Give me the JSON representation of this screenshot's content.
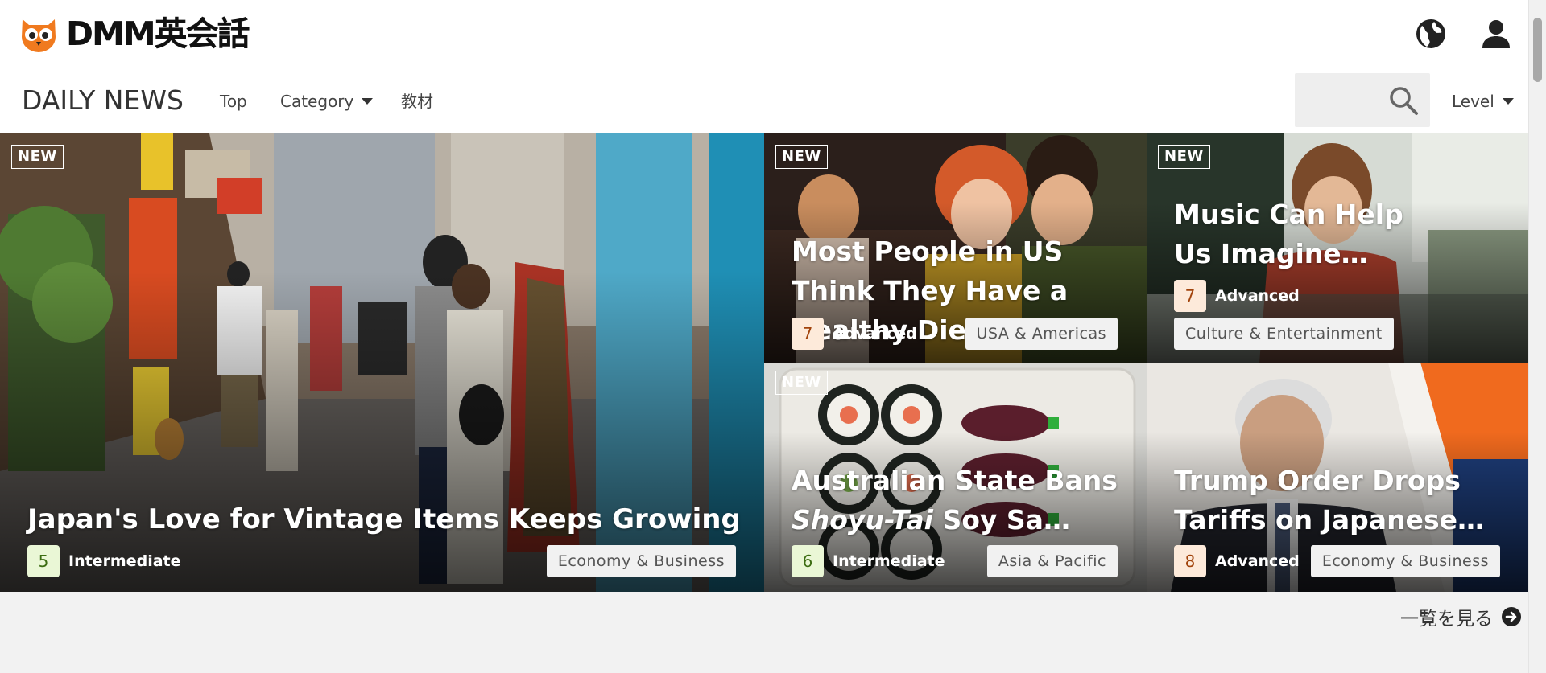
{
  "logo": {
    "text": "DMM英会話"
  },
  "header": {
    "brand": "DAILY NEWS"
  },
  "nav": {
    "top": "Top",
    "category": "Category",
    "kyozai": "教材",
    "level": "Level"
  },
  "colors": {
    "owl": "#f07a1f",
    "intermediate_badge": "#eaf7d6",
    "advanced_badge": "#fdeada"
  },
  "icons": {
    "globe": "globe-icon",
    "user": "user-icon",
    "search": "search-icon",
    "arrow": "arrow-right-circle-icon"
  },
  "articles": [
    {
      "new_label": "NEW",
      "title": "Japan's Love for Vintage Items Keeps Growing",
      "level_num": "5",
      "level": "Intermediate",
      "category": "Economy & Business"
    },
    {
      "new_label": "NEW",
      "title": "Most People in US Think They Have a Healthy Diet",
      "level_num": "7",
      "level": "Advanced",
      "category": "USA & Americas"
    },
    {
      "new_label": "NEW",
      "title": "Music Can Help Us Imagine Social Activities",
      "level_num": "7",
      "level": "Advanced",
      "category": "Culture & Entertainment"
    },
    {
      "new_label": "NEW",
      "title_italic": "Shoyu-Tai",
      "title_pre": "Australian State Bans ",
      "title_post": " Soy Sauce Fish",
      "level_num": "6",
      "level": "Intermediate",
      "category": "Asia & Pacific"
    },
    {
      "title": "Trump Order Drops Tariffs on Japanese Cars",
      "level_num": "8",
      "level": "Advanced",
      "category": "Economy & Business"
    }
  ],
  "footer": {
    "see_all": "一覧を見る"
  }
}
